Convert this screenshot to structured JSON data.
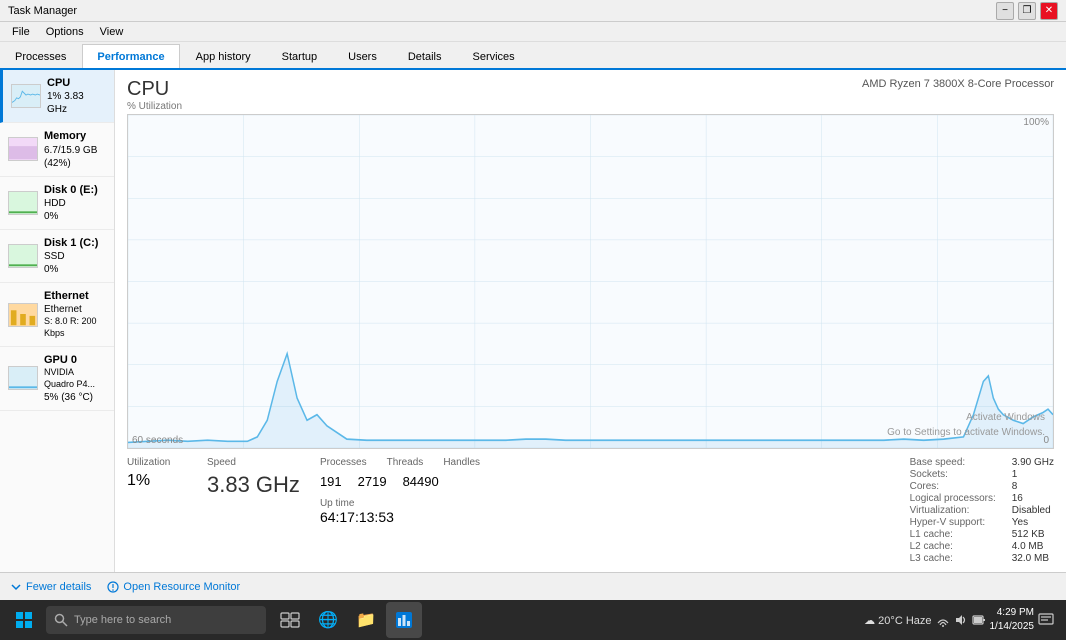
{
  "titlebar": {
    "title": "Task Manager",
    "min_label": "−",
    "restore_label": "❐",
    "close_label": "✕"
  },
  "menubar": {
    "items": [
      "File",
      "Options",
      "View"
    ]
  },
  "tabs": [
    {
      "label": "Processes",
      "active": false
    },
    {
      "label": "Performance",
      "active": true
    },
    {
      "label": "App history",
      "active": false
    },
    {
      "label": "Startup",
      "active": false
    },
    {
      "label": "Users",
      "active": false
    },
    {
      "label": "Details",
      "active": false
    },
    {
      "label": "Services",
      "active": false
    }
  ],
  "sidebar": {
    "items": [
      {
        "id": "cpu",
        "name": "CPU",
        "detail1": "1% 3.83 GHz",
        "active": true
      },
      {
        "id": "memory",
        "name": "Memory",
        "detail1": "6.7/15.9 GB (42%)",
        "active": false
      },
      {
        "id": "disk0",
        "name": "Disk 0 (E:)",
        "detail2": "HDD",
        "detail1": "0%",
        "active": false
      },
      {
        "id": "disk1",
        "name": "Disk 1 (C:)",
        "detail2": "SSD",
        "detail1": "0%",
        "active": false
      },
      {
        "id": "ethernet",
        "name": "Ethernet",
        "detail2": "Ethernet",
        "detail1": "S: 8.0 R: 200 Kbps",
        "active": false
      },
      {
        "id": "gpu0",
        "name": "GPU 0",
        "detail2": "NVIDIA Quadro P4...",
        "detail1": "5% (36 °C)",
        "active": false
      }
    ]
  },
  "cpu": {
    "title": "CPU",
    "processor": "AMD Ryzen 7 3800X 8-Core Processor",
    "chart": {
      "y_label": "% Utilization",
      "y_max": "100%",
      "y_zero": "0",
      "x_label": "60 seconds"
    },
    "stats": {
      "utilization_label": "Utilization",
      "utilization_value": "1%",
      "speed_label": "Speed",
      "speed_value": "3.83 GHz",
      "base_speed_label": "Base speed:",
      "base_speed_value": "3.90 GHz",
      "sockets_label": "Sockets:",
      "sockets_value": "1",
      "cores_label": "Cores:",
      "cores_value": "8",
      "logical_label": "Logical processors:",
      "logical_value": "16",
      "virt_label": "Virtualization:",
      "virt_value": "Disabled",
      "hyperv_label": "Hyper-V support:",
      "hyperv_value": "Yes",
      "l1_label": "L1 cache:",
      "l1_value": "512 KB",
      "l2_label": "L2 cache:",
      "l2_value": "4.0 MB",
      "l3_label": "L3 cache:",
      "l3_value": "32.0 MB",
      "processes_label": "Processes",
      "processes_value": "191",
      "threads_label": "Threads",
      "threads_value": "2719",
      "handles_label": "Handles",
      "handles_value": "84490",
      "uptime_label": "Up time",
      "uptime_value": "64:17:13:53"
    }
  },
  "bottom_bar": {
    "fewer_label": "Fewer details",
    "monitor_label": "Open Resource Monitor"
  },
  "taskbar": {
    "search_placeholder": "Type here to search",
    "tray": {
      "weather": "20°C  Haze",
      "time": "4:29 PM",
      "date": "1/14/2025"
    }
  },
  "watermark": {
    "line1": "Activate Windows",
    "line2": "Go to Settings to activate Windows."
  }
}
